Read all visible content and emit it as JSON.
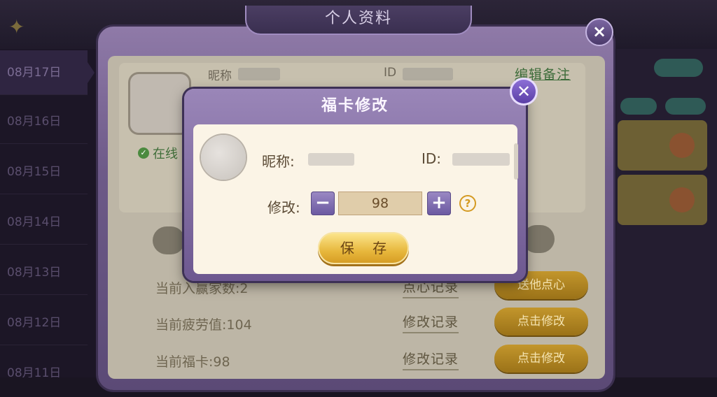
{
  "background": {
    "dates": [
      "08月17日",
      "08月16日",
      "08月15日",
      "08月14日",
      "08月13日",
      "08月12日",
      "08月11日"
    ],
    "active_date_index": 0
  },
  "profile_window": {
    "title": "个人资料",
    "nickname_label": "昵称",
    "id_label": "ID",
    "edit_note": "编辑备注",
    "online_status": "在线",
    "stats": [
      {
        "text": "当前入赢家数:2",
        "link": "点心记录",
        "button": "送他点心"
      },
      {
        "text": "当前疲劳值:104",
        "link": "修改记录",
        "button": "点击修改"
      },
      {
        "text": "当前福卡:98",
        "link": "修改记录",
        "button": "点击修改"
      }
    ],
    "close_icon": "close-icon"
  },
  "modal": {
    "title": "福卡修改",
    "nickname_label": "昵称:",
    "id_label": "ID:",
    "edit_label": "修改:",
    "value": "98",
    "minus": "−",
    "plus": "+",
    "help": "?",
    "save_label": "保 存",
    "close_icon": "close-icon"
  }
}
